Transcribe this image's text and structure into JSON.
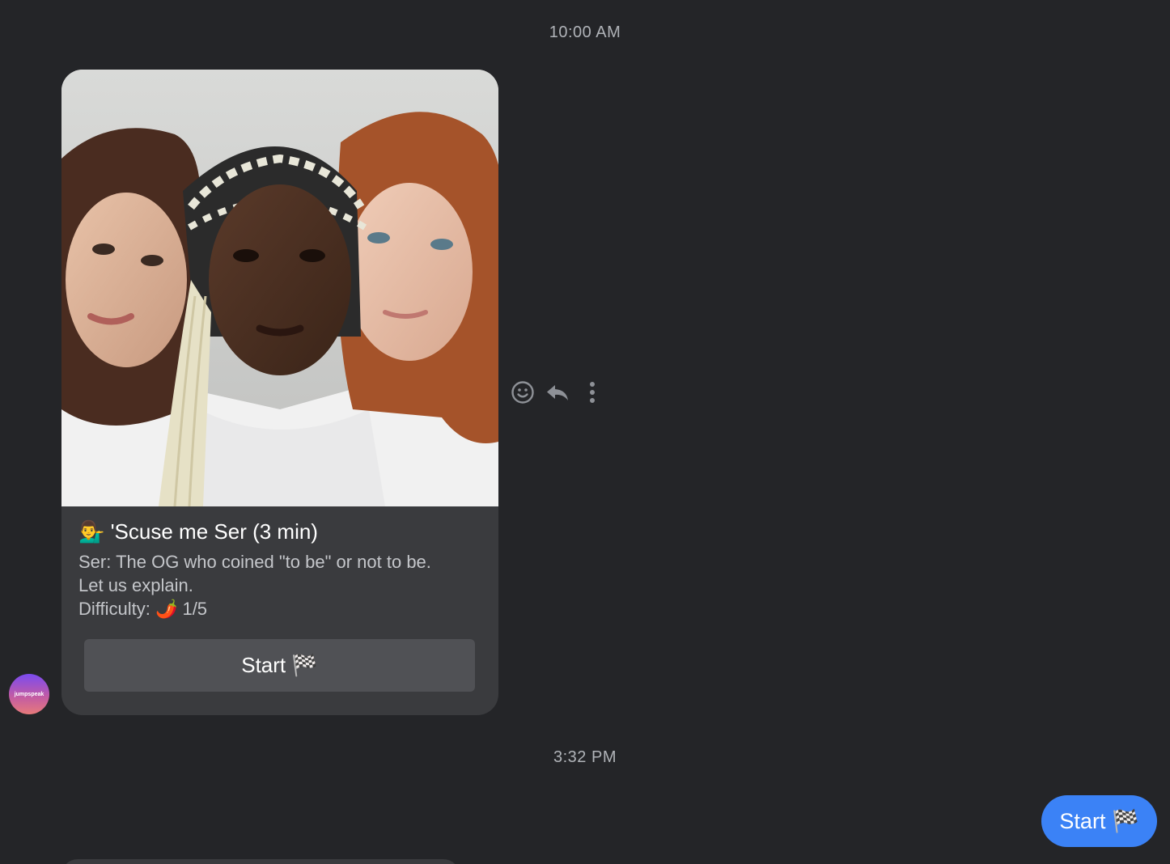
{
  "timestamps": {
    "first": "10:00 AM",
    "second": "3:32 PM"
  },
  "card": {
    "image_alt": "three-women-photo",
    "title": "💁‍♂️ 'Scuse me Ser (3 min)",
    "description_lines": [
      "Ser: The OG who coined \"to be\" or not to be.",
      "Let us explain.",
      "Difficulty: 🌶️ 1/5"
    ],
    "button_label": "Start 🏁"
  },
  "avatar": {
    "label": "jumpspeak"
  },
  "message_actions": {
    "icons": [
      "smiley-icon",
      "reply-icon",
      "more-vertical-icon"
    ]
  },
  "sent_message": {
    "text": "Start 🏁"
  },
  "colors": {
    "background": "#242528",
    "card": "#3a3b3e",
    "card_button": "#505155",
    "sent_bubble": "#3b82f6",
    "timestamp": "#b0b3b8"
  }
}
